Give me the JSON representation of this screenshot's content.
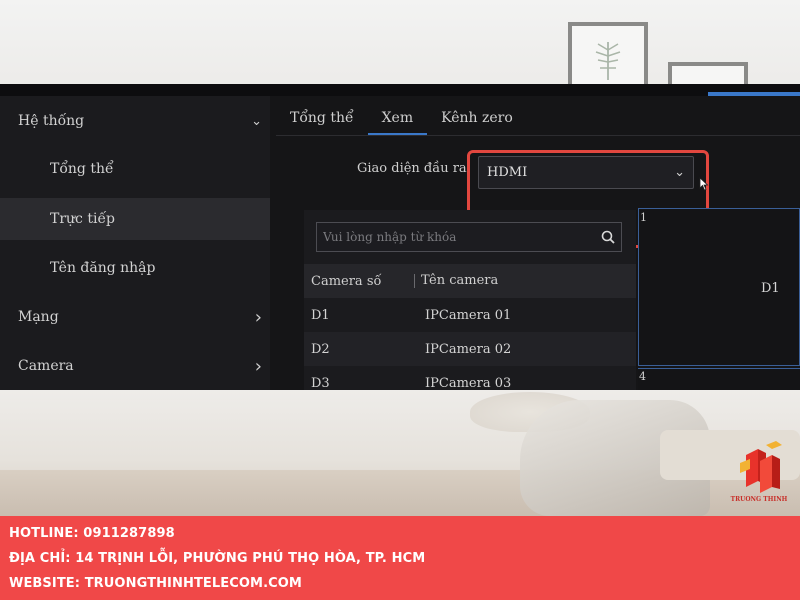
{
  "sidebar": {
    "items": [
      {
        "label": "Hệ thống",
        "chevron": "chevron-down"
      },
      {
        "label": "Tổng thể"
      },
      {
        "label": "Trực tiếp"
      },
      {
        "label": "Tên đăng nhập"
      },
      {
        "label": "Mạng",
        "chevron": "chevron-right"
      },
      {
        "label": "Camera",
        "chevron": "chevron-right"
      }
    ],
    "chevrons": {
      "down": "⌄",
      "right": "›"
    }
  },
  "tabs": [
    {
      "label": "Tổng thể"
    },
    {
      "label": "Xem"
    },
    {
      "label": "Kênh zero"
    }
  ],
  "output": {
    "label": "Giao diện đầu ra",
    "value": "HDMI",
    "arrow": "⌄"
  },
  "search": {
    "placeholder": "Vui lòng nhập từ khóa"
  },
  "table": {
    "headers": [
      "Camera số",
      "Tên camera"
    ],
    "rows": [
      [
        "D1",
        "IPCamera 01"
      ],
      [
        "D2",
        "IPCamera 02"
      ],
      [
        "D3",
        "IPCamera 03"
      ]
    ]
  },
  "preview": {
    "window_number": "1",
    "channel_label": "D1",
    "next_window_number": "4"
  },
  "logo": {
    "text": "TRUONG THINH"
  },
  "footer": {
    "hotline": "HOTLINE: 0911287898",
    "address": "ĐỊA CHỈ: 14 TRỊNH LỖI, PHƯỜNG PHÚ THỌ HÒA, TP. HCM",
    "website": "WEBSITE: TRUONGTHINHTELECOM.COM"
  },
  "colors": {
    "footer_bg": "#f04848",
    "highlight": "#e2473f",
    "accent_blue": "#3a78c9",
    "ui_bg": "#151517"
  }
}
